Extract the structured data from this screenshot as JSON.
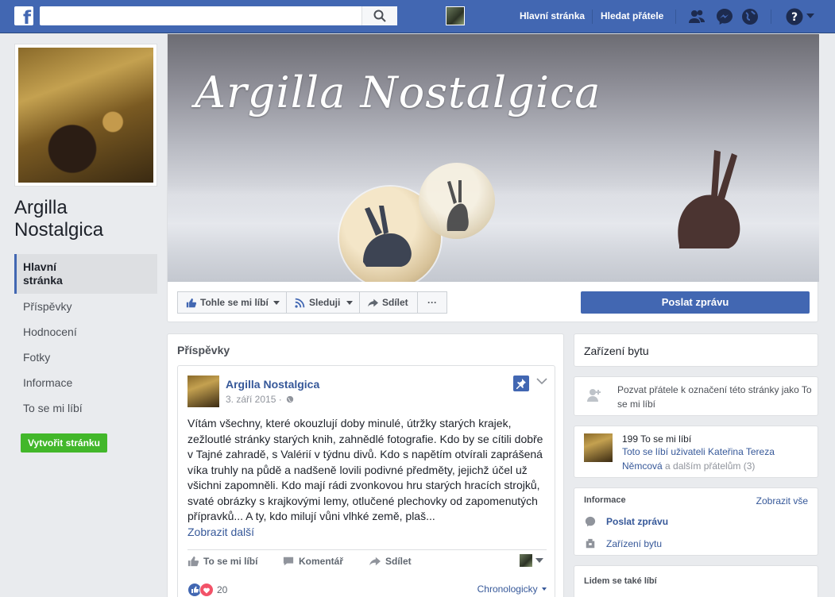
{
  "topbar": {
    "logo_letter": "f",
    "search_value": "",
    "nav": [
      "Hlavní stránka",
      "Hledat přátele"
    ]
  },
  "page": {
    "name": "Argilla Nostalgica",
    "cover_title": "Argilla Nostalgica"
  },
  "left_nav": {
    "items": [
      {
        "label": "Hlavní\nstránka",
        "active": true
      },
      {
        "label": "Příspěvky"
      },
      {
        "label": "Hodnocení"
      },
      {
        "label": "Fotky"
      },
      {
        "label": "Informace"
      },
      {
        "label": "To se mi líbí"
      }
    ],
    "create_button": "Vytvořit stránku"
  },
  "actions": {
    "like": "Tohle se mi líbí",
    "follow": "Sleduji",
    "share": "Sdílet",
    "more": "···",
    "message": "Poslat zprávu"
  },
  "posts": {
    "title": "Příspěvky",
    "post": {
      "author": "Argilla Nostalgica",
      "date": "3. září 2015 ·",
      "text": "Vítám všechny, které okouzlují doby minulé, útržky starých krajek, zežloutlé stránky starých knih, zahnědlé fotografie. Kdo by se cítili dobře v Tajné zahradě, s Valérií v týdnu divů. Kdo s napětím otvírali zaprášená víka truhly na půdě a nadšeně lovili podivné předměty, jejichž účel už všichni zapomněli. Kdo mají rádi zvonkovou hru starých hracích strojků, svaté obrázky s krajkovými lemy, otlučené plechovky od zapomenutých přípravků... A ty, kdo milují vůni vlhké země, plaš...",
      "see_more": "Zobrazit další",
      "action_like": "To se mi líbí",
      "action_comment": "Komentář",
      "action_share": "Sdílet",
      "reactions_count": "20",
      "sort": "Chronologicky"
    }
  },
  "right": {
    "category": "Zařízení bytu",
    "invite_text": "Pozvat přátele k označení této stránky jako To se mi líbí",
    "likes_count": "199 To se mi líbí",
    "likes_friends_link": "Toto se líbí uživateli Kateřina Tereza Němcová",
    "likes_friends_rest": " a dalším přátelům (3)",
    "info_title": "Informace",
    "info_show_all": "Zobrazit vše",
    "info_message": "Poslat zprávu",
    "info_category": "Zařízení bytu",
    "also_like": "Lidem se také líbí"
  },
  "colors": {
    "brand": "#4267b2",
    "link": "#365899",
    "create": "#42b72a",
    "background": "#e9ebee"
  }
}
